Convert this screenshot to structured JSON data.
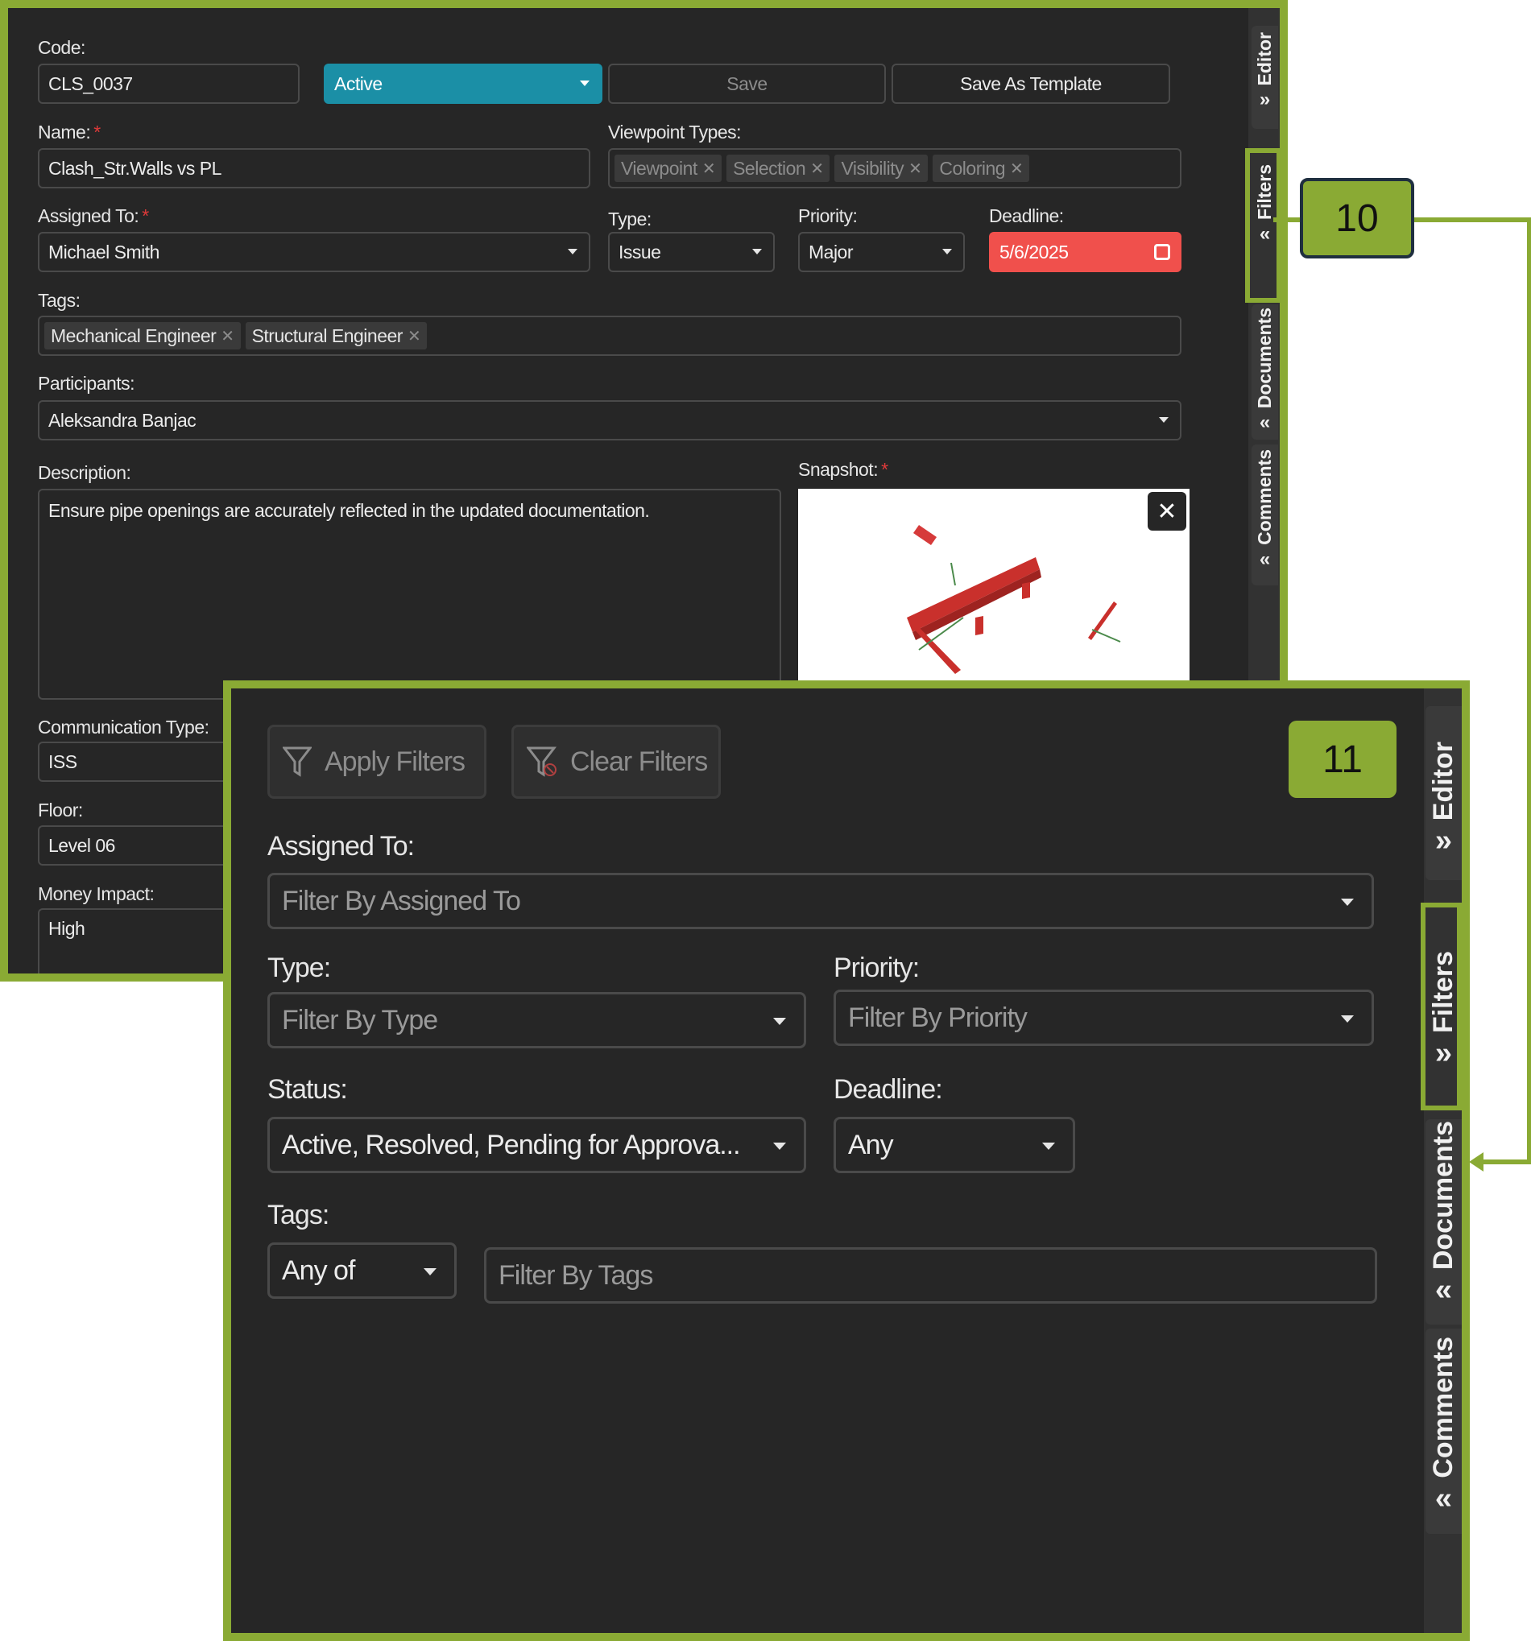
{
  "editor": {
    "code_label": "Code:",
    "code_value": "CLS_0037",
    "status_value": "Active",
    "save_label": "Save",
    "save_template_label": "Save As Template",
    "name_label": "Name:",
    "name_value": "Clash_Str.Walls vs PL",
    "viewpoint_types_label": "Viewpoint Types:",
    "viewpoint_types": [
      "Viewpoint",
      "Selection",
      "Visibility",
      "Coloring"
    ],
    "assigned_label": "Assigned To:",
    "assigned_value": "Michael Smith",
    "type_label": "Type:",
    "type_value": "Issue",
    "priority_label": "Priority:",
    "priority_value": "Major",
    "deadline_label": "Deadline:",
    "deadline_value": "5/6/2025",
    "tags_label": "Tags:",
    "tags": [
      "Mechanical Engineer",
      "Structural Engineer"
    ],
    "participants_label": "Participants:",
    "participants_value": "Aleksandra Banjac",
    "description_label": "Description:",
    "description_value": "Ensure pipe openings are accurately reflected in the updated documentation.",
    "snapshot_label": "Snapshot:",
    "communication_label": "Communication Type:",
    "communication_value": "ISS",
    "floor_label": "Floor:",
    "floor_value": "Level 06",
    "money_label": "Money Impact:",
    "money_value": "High",
    "required_mark": "*",
    "side_tabs": [
      "Editor",
      "Filters",
      "Documents",
      "Comments"
    ]
  },
  "filters": {
    "apply_label": "Apply Filters",
    "clear_label": "Clear Filters",
    "assigned_label": "Assigned To:",
    "assigned_placeholder": "Filter By Assigned To",
    "type_label": "Type:",
    "type_placeholder": "Filter By Type",
    "priority_label": "Priority:",
    "priority_placeholder": "Filter By Priority",
    "status_label": "Status:",
    "status_value": "Active, Resolved, Pending for Approva...",
    "deadline_label": "Deadline:",
    "deadline_value": "Any",
    "tags_label": "Tags:",
    "tags_mode": "Any of",
    "tags_placeholder": "Filter By Tags",
    "side_tabs": [
      "Editor",
      "Filters",
      "Documents",
      "Comments"
    ]
  },
  "callouts": {
    "first": "10",
    "second": "11"
  },
  "colors": {
    "accent_green": "#8aaa34",
    "status_teal": "#1b8fa6",
    "deadline_red": "#f0504c",
    "panel_bg": "#262626"
  }
}
